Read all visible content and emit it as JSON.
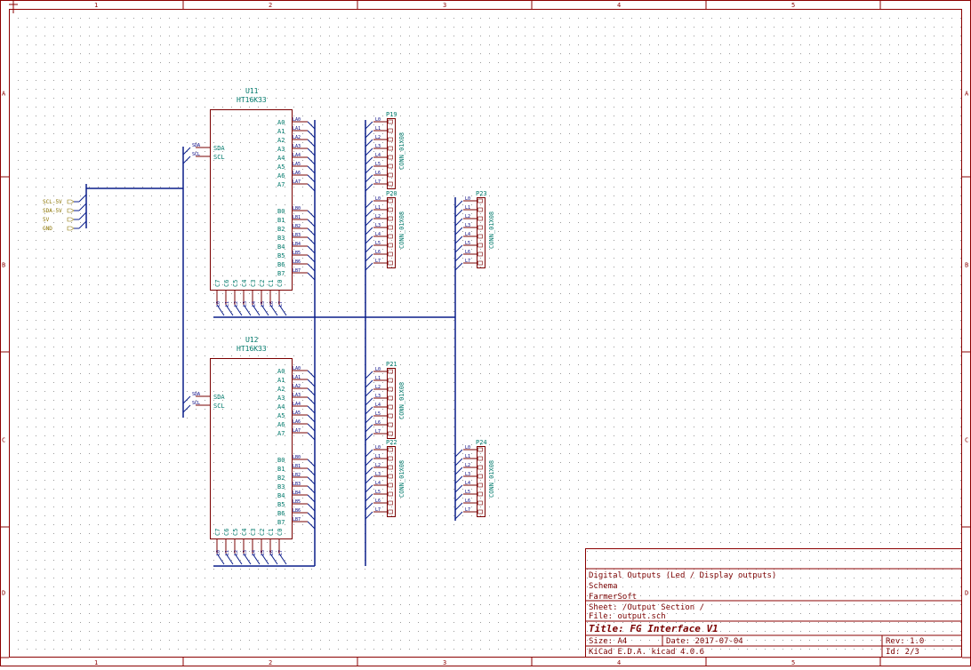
{
  "colors": {
    "frame": "#8b0000",
    "wire": "#0a1e8a",
    "pin": "#7a0000",
    "label": "#00796b",
    "text": "#000080",
    "grid": "#9a9a9a",
    "hlabel": "#8a7300"
  },
  "border": {
    "columns": [
      "1",
      "2",
      "3",
      "4",
      "5"
    ],
    "rows": [
      "A",
      "B",
      "C",
      "D"
    ]
  },
  "chips": [
    {
      "ref": "U11",
      "value": "HT16K33",
      "pins_right": [
        "A0",
        "A1",
        "A2",
        "A3",
        "A4",
        "A5",
        "A6",
        "A7",
        "B0",
        "B1",
        "B2",
        "B3",
        "B4",
        "B5",
        "B6",
        "B7"
      ],
      "pins_left": [
        "SDA",
        "SCL"
      ],
      "pins_bottom": [
        "C7",
        "C6",
        "C5",
        "C4",
        "C3",
        "C2",
        "C1",
        "C0"
      ],
      "net_labels_left": [
        "SDA",
        "SCL"
      ]
    },
    {
      "ref": "U12",
      "value": "HT16K33",
      "pins_right": [
        "A0",
        "A1",
        "A2",
        "A3",
        "A4",
        "A5",
        "A6",
        "A7",
        "B0",
        "B1",
        "B2",
        "B3",
        "B4",
        "B5",
        "B6",
        "B7"
      ],
      "pins_left": [
        "SDA",
        "SCL"
      ],
      "pins_bottom": [
        "C7",
        "C6",
        "C5",
        "C4",
        "C3",
        "C2",
        "C1",
        "C0"
      ],
      "net_labels_left": [
        "SDA",
        "SCL"
      ]
    }
  ],
  "connectors": [
    {
      "ref": "P19",
      "value": "CONN_01X08"
    },
    {
      "ref": "P20",
      "value": "CONN_01X08"
    },
    {
      "ref": "P21",
      "value": "CONN_01X08"
    },
    {
      "ref": "P22",
      "value": "CONN_01X08"
    },
    {
      "ref": "P23",
      "value": "CONN_01X08"
    },
    {
      "ref": "P24",
      "value": "CONN_01X08"
    }
  ],
  "hier_labels": [
    "SCL-5V",
    "SDA-5V",
    "5V",
    "GND"
  ],
  "title_block": {
    "comment1": "Digital Outputs (Led / Display outputs)",
    "comment2": "Schema",
    "company": "FarmerSoft",
    "sheet": "Sheet: /Output Section /",
    "file": "File: output.sch",
    "title": "Title: FG Interface V1",
    "size": "Size: A4",
    "date": "Date: 2017-07-04",
    "rev": "Rev: 1.0",
    "tool": "KiCad E.D.A.  kicad 4.0.6",
    "id": "Id: 2/3"
  }
}
